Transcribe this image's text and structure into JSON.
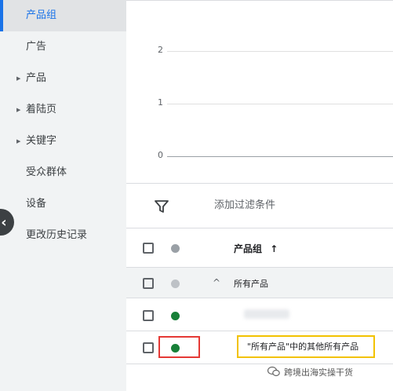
{
  "sidebar": {
    "items": [
      {
        "label": "产品组",
        "active": true,
        "has_caret": false
      },
      {
        "label": "广告",
        "active": false,
        "has_caret": false
      },
      {
        "label": "产品",
        "active": false,
        "has_caret": true
      },
      {
        "label": "着陆页",
        "active": false,
        "has_caret": true
      },
      {
        "label": "关键字",
        "active": false,
        "has_caret": true
      },
      {
        "label": "受众群体",
        "active": false,
        "has_caret": false
      },
      {
        "label": "设备",
        "active": false,
        "has_caret": false
      },
      {
        "label": "更改历史记录",
        "active": false,
        "has_caret": false
      }
    ]
  },
  "chart_data": {
    "type": "line",
    "y_ticks": [
      "2",
      "1",
      "0"
    ],
    "ylim": [
      0,
      2
    ],
    "series": []
  },
  "filter": {
    "label": "添加过滤条件",
    "icon": "filter-icon"
  },
  "table": {
    "header": {
      "label": "产品组",
      "sort_icon": "arrow-up-icon",
      "sort_glyph": "↑"
    },
    "group_row": {
      "label": "所有产品",
      "chevron": "^"
    },
    "rows": [
      {
        "label": "",
        "status": "enabled",
        "blurred": true
      },
      {
        "label": "\"所有产品\"中的其他所有产品",
        "status": "enabled",
        "blurred": false
      }
    ]
  },
  "colors": {
    "accent": "#1a73e8",
    "status_enabled": "#188038",
    "highlight_red": "#e53935",
    "highlight_yellow": "#f2c200"
  },
  "watermark": {
    "text": "跨境出海实操干货",
    "icon": "wechat-icon"
  }
}
